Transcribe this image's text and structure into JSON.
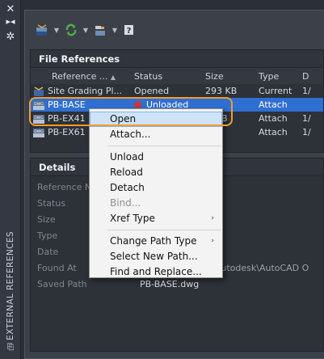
{
  "palette": {
    "panel_bg": "#3b4049",
    "selection": "#2f6fd1",
    "highlight_outline": "#f59b2a",
    "menu_bg": "#f3f3f3"
  },
  "strip": {
    "icons": [
      "close-icon",
      "pin-icon",
      "settings-icon",
      "properties-icon"
    ],
    "title": "EXTERNAL REFERENCES"
  },
  "toolbar": {
    "icons": [
      "attach-dwg-icon",
      "refresh-icon",
      "change-path-icon",
      "help-icon"
    ]
  },
  "file_references": {
    "title": "File References",
    "columns": [
      "Reference ...",
      "Status",
      "Size",
      "Type",
      "D"
    ],
    "sort_indicator": "▲",
    "rows": [
      {
        "name": "Site Grading Pl...",
        "status": "Opened",
        "size": "293 KB",
        "type": "Current",
        "date": "1/"
      },
      {
        "name": "PB-BASE",
        "status": "Unloaded",
        "size": "",
        "type": "Attach",
        "date": ""
      },
      {
        "name": "PB-EX41",
        "status": "",
        "size": "6 MB",
        "type": "Attach",
        "date": "1/"
      },
      {
        "name": "PB-EX61",
        "status": "",
        "size": "KB",
        "type": "Attach",
        "date": "1/"
      }
    ]
  },
  "details": {
    "title": "Details",
    "rows": [
      {
        "key": "Reference N",
        "value": ""
      },
      {
        "key": "Status",
        "value": ""
      },
      {
        "key": "Size",
        "value": ""
      },
      {
        "key": "Type",
        "value": ""
      },
      {
        "key": "Date",
        "value": ""
      },
      {
        "key": "Found At",
        "value": "C:\\Program Files\\Autodesk\\AutoCAD O"
      },
      {
        "key": "Saved Path",
        "value": "PB-BASE.dwg"
      }
    ]
  },
  "context_menu": {
    "items": {
      "open": "Open",
      "attach": "Attach...",
      "unload": "Unload",
      "reload": "Reload",
      "detach": "Detach",
      "bind": "Bind...",
      "xref_type": "Xref Type",
      "change_path_type": "Change Path Type",
      "select_new_path": "Select New Path...",
      "find_and_replace": "Find and Replace..."
    },
    "submenu_arrow": "›"
  }
}
